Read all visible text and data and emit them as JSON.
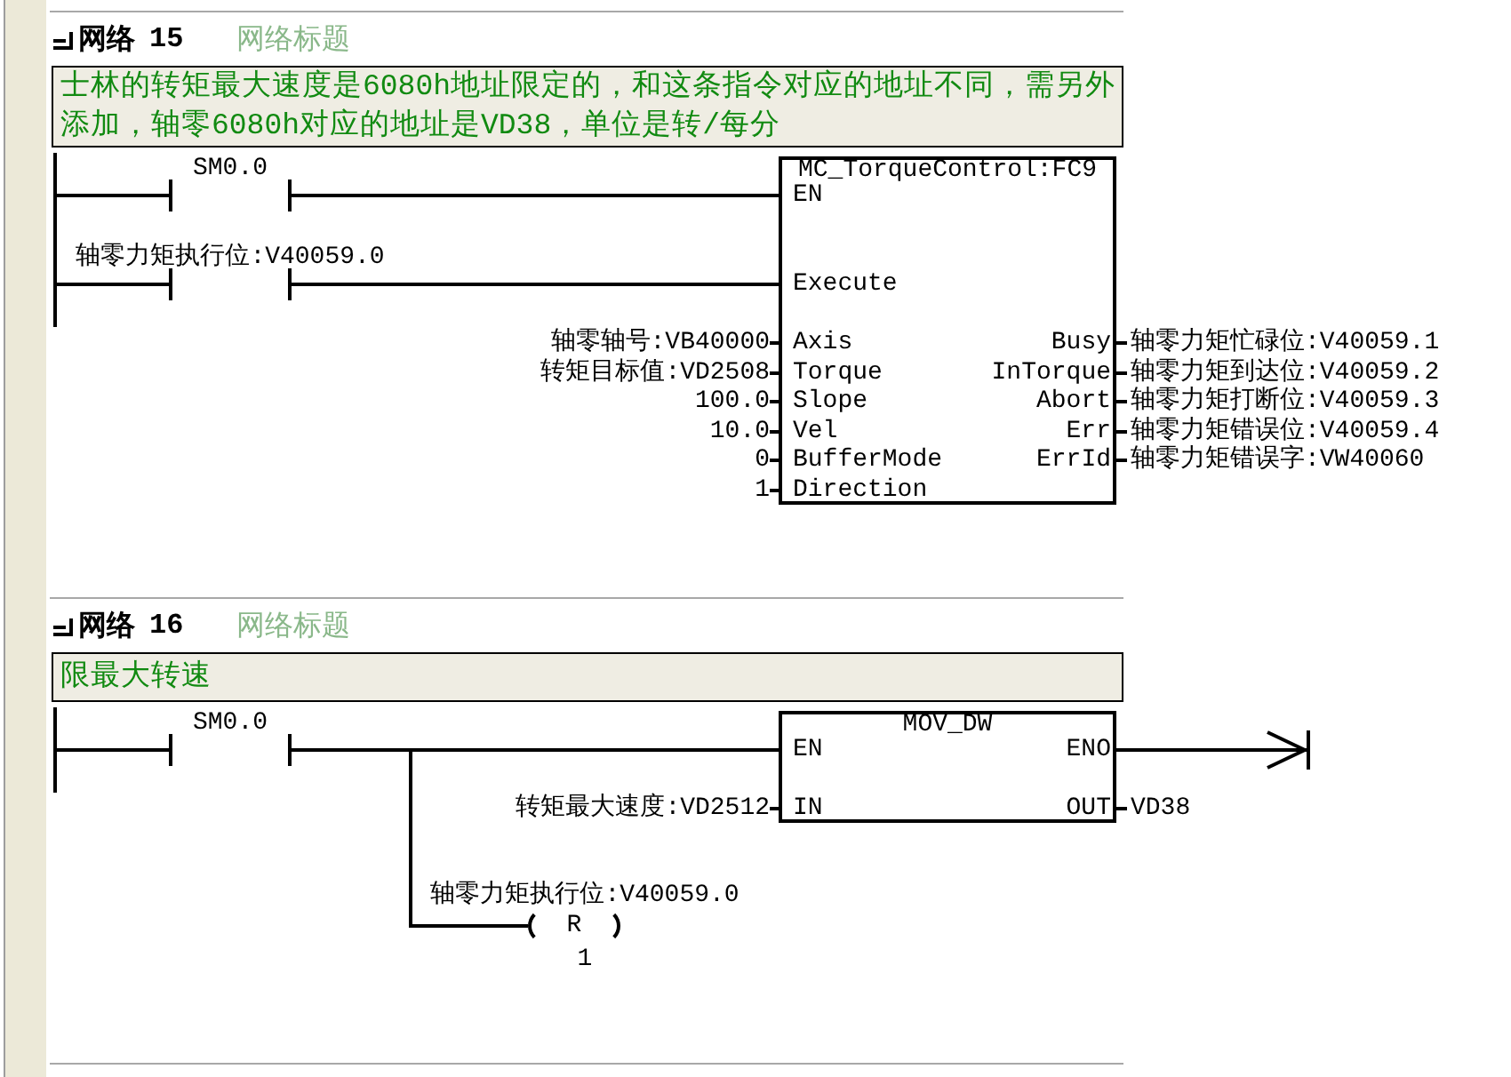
{
  "networks": [
    {
      "label": "网络",
      "number": "15",
      "title": "网络标题",
      "comment": "士林的转矩最大速度是6080h地址限定的，和这条指令对应的地址不同，需另外添加，轴零6080h对应的地址是VD38，单位是转/每分",
      "rungs": [
        {
          "contact": "SM0.0"
        },
        {
          "contact": "轴零力矩执行位:V40059.0"
        }
      ],
      "block": {
        "title": "MC_TorqueControl:FC9",
        "inputs": [
          {
            "kind": "rung",
            "pin": "EN"
          },
          {
            "kind": "rung",
            "pin": "Execute"
          },
          {
            "kind": "value",
            "pin": "Axis",
            "value": "轴零轴号:VB40000"
          },
          {
            "kind": "value",
            "pin": "Torque",
            "value": "转矩目标值:VD2508"
          },
          {
            "kind": "value",
            "pin": "Slope",
            "value": "100.0"
          },
          {
            "kind": "value",
            "pin": "Vel",
            "value": "10.0"
          },
          {
            "kind": "value",
            "pin": "BufferMode",
            "value": "0"
          },
          {
            "kind": "value",
            "pin": "Direction",
            "value": "1"
          }
        ],
        "outputs": [
          {
            "kind": "value",
            "pin": "Busy",
            "value": "轴零力矩忙碌位:V40059.1"
          },
          {
            "kind": "value",
            "pin": "InTorque",
            "value": "轴零力矩到达位:V40059.2"
          },
          {
            "kind": "value",
            "pin": "Abort",
            "value": "轴零力矩打断位:V40059.3"
          },
          {
            "kind": "value",
            "pin": "Err",
            "value": "轴零力矩错误位:V40059.4"
          },
          {
            "kind": "value",
            "pin": "ErrId",
            "value": "轴零力矩错误字:VW40060"
          }
        ]
      }
    },
    {
      "label": "网络",
      "number": "16",
      "title": "网络标题",
      "comment": "限最大转速",
      "rungs": [
        {
          "contact": "SM0.0"
        }
      ],
      "block": {
        "title": "MOV_DW",
        "inputs": [
          {
            "kind": "rung",
            "pin": "EN"
          },
          {
            "kind": "value",
            "pin": "IN",
            "value": "转矩最大速度:VD2512"
          }
        ],
        "outputs": [
          {
            "kind": "arrow",
            "pin": "ENO"
          },
          {
            "kind": "value",
            "pin": "OUT",
            "value": "VD38"
          }
        ]
      },
      "coil": {
        "operand": "轴零力矩执行位:V40059.0",
        "op": "R",
        "count": "1"
      }
    }
  ]
}
